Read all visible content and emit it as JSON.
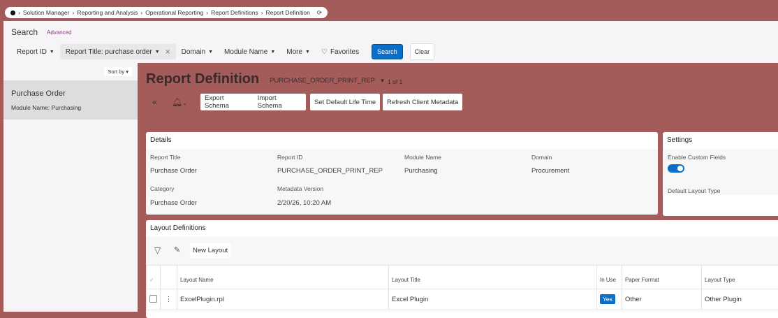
{
  "breadcrumb": [
    "Solution Manager",
    "Reporting and Analysis",
    "Operational Reporting",
    "Report Definitions",
    "Report Definition"
  ],
  "search": {
    "title": "Search",
    "advanced": "Advanced",
    "filters": [
      "Report ID",
      "Report Title: purchase order",
      "Domain",
      "Module Name",
      "More"
    ],
    "favorites": "Favorites",
    "search_btn": "Search",
    "clear_btn": "Clear"
  },
  "list": {
    "sort": "Sort by",
    "item_title": "Purchase Order",
    "item_module": "Module Name:  Purchasing"
  },
  "header": {
    "title": "Report Definition",
    "id": "PURCHASE_ORDER_PRINT_REP",
    "pager": "1 of 1"
  },
  "toolbar": {
    "export": "Export Schema",
    "import": "Import Schema",
    "lifetime": "Set Default Life Time",
    "refresh": "Refresh Client Metadata"
  },
  "details": {
    "title": "Details",
    "report_title_lbl": "Report Title",
    "report_title": "Purchase Order",
    "report_id_lbl": "Report ID",
    "report_id": "PURCHASE_ORDER_PRINT_REP",
    "module_lbl": "Module Name",
    "module": "Purchasing",
    "domain_lbl": "Domain",
    "domain": "Procurement",
    "category_lbl": "Category",
    "category": "Purchase Order",
    "metadata_lbl": "Metadata Version",
    "metadata": "2/20/26, 10:20 AM"
  },
  "settings": {
    "title": "Settings",
    "custom_fields": "Enable Custom Fields",
    "custom_fields_on": true,
    "layout_type": "Default Layout Type"
  },
  "layouts": {
    "title": "Layout Definitions",
    "new": "New Layout",
    "columns": [
      "Layout Name",
      "Layout Title",
      "In Use",
      "Paper Format",
      "Layout Type"
    ],
    "rows": [
      {
        "name": "ExcelPlugin.rpl",
        "title": "Excel Plugin",
        "in_use": "Yes",
        "paper": "Other",
        "type": "Other Plugin"
      }
    ]
  }
}
